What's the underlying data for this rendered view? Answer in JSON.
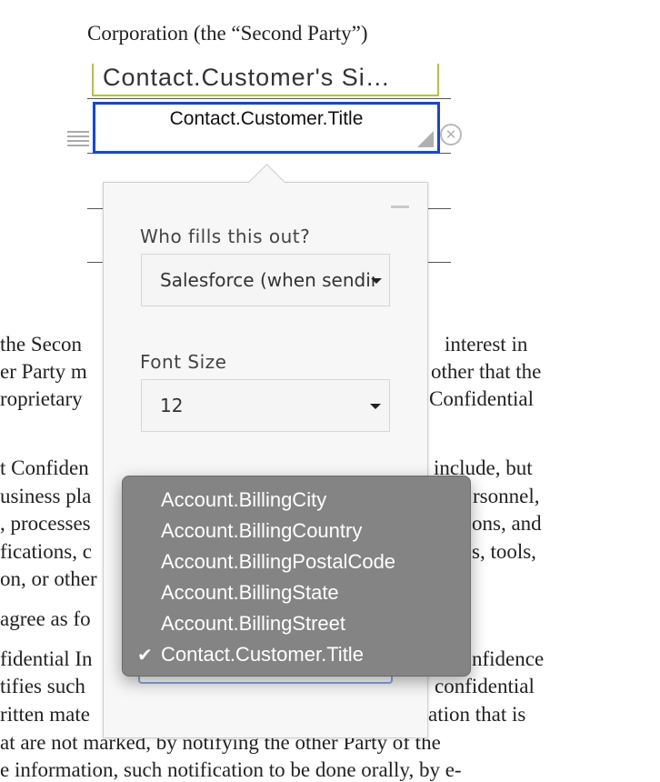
{
  "document": {
    "heading_line": "Corporation (the “Second Party”)",
    "left_fragments": [
      "the Secon",
      "er Party m",
      "roprietary",
      "t Confiden",
      "usiness pla",
      ", processes",
      "fications, c",
      "on, or other",
      "agree as fo",
      "fidential In",
      "tifies such",
      "ritten mate"
    ],
    "right_fragments": [
      "interest in",
      "other that the",
      "Confidential",
      "include, but",
      "rsonnel,",
      "ons, and",
      "s, tools,",
      "nfidence",
      "confidential",
      "ation that is"
    ],
    "bottom_lines": [
      "at are not marked, by notifying the other Party of the",
      "e information, such notification to be done orally, by e-"
    ]
  },
  "fields": {
    "signature_field": "Contact.Customer's Si…",
    "title_field": "Contact.Customer.Title"
  },
  "panel": {
    "who_label": "Who fills this out?",
    "who_value": "Salesforce (when sending)",
    "font_size_label": "Font Size",
    "font_size_value": "12"
  },
  "dropdown": {
    "items": [
      "Account.BillingCity",
      "Account.BillingCountry",
      "Account.BillingPostalCode",
      "Account.BillingState",
      "Account.BillingStreet",
      "Contact.Customer.Title"
    ],
    "selected": "Contact.Customer.Title",
    "check_glyph": "✔"
  },
  "icons": {
    "close": "close-icon",
    "drag": "drag-handle-icon",
    "resize": "resize-icon",
    "minimize": "minimize-icon",
    "caret": "chevron-down-icon"
  },
  "colors": {
    "selected_field_border": "#1a44d8",
    "signature_field_border": "#b5c53a",
    "dropdown_bg": "#848484"
  }
}
